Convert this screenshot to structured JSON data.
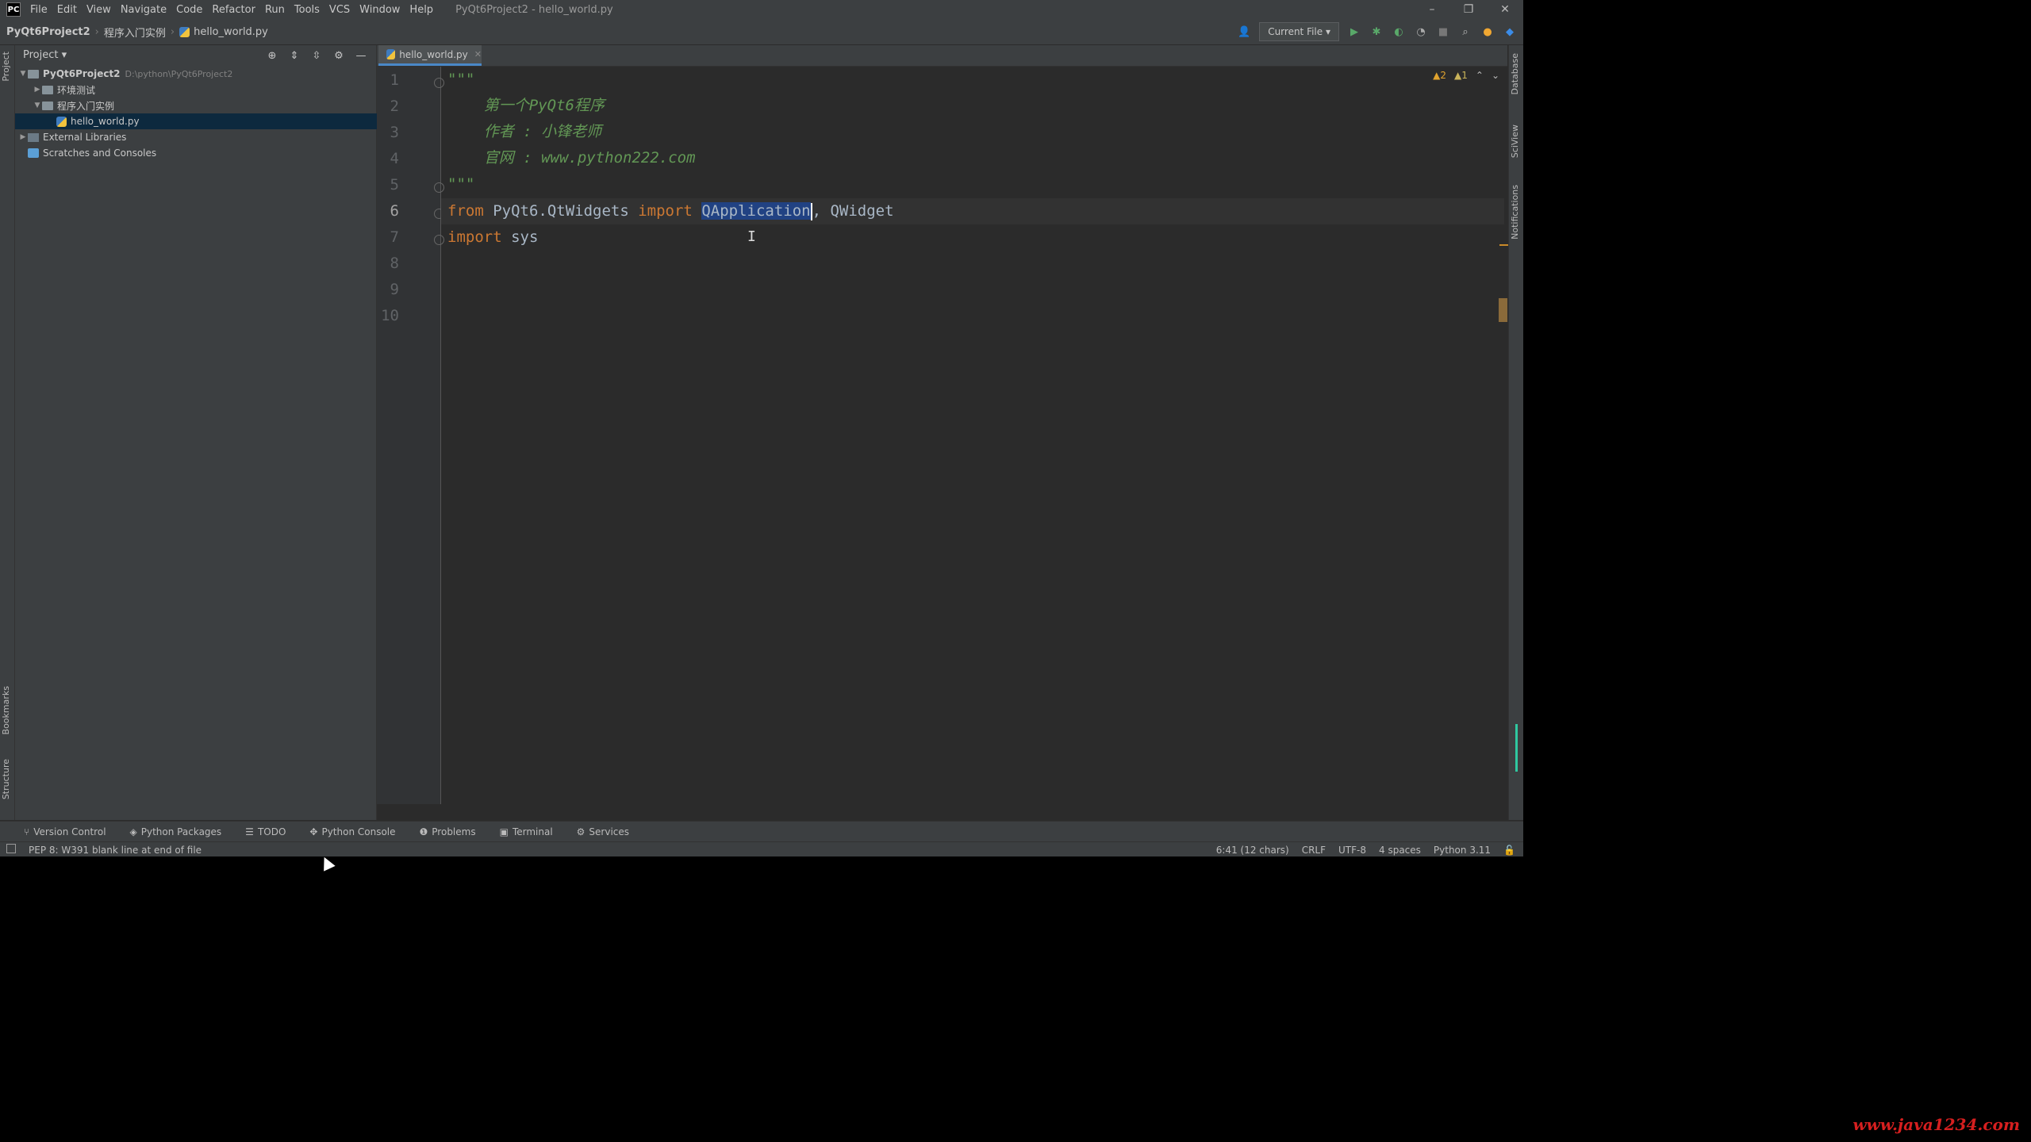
{
  "window": {
    "title": "PyQt6Project2 - hello_world.py",
    "logo": "PC",
    "controls": [
      "–",
      "❐",
      "✕"
    ]
  },
  "menu": [
    "File",
    "Edit",
    "View",
    "Navigate",
    "Code",
    "Refactor",
    "Run",
    "Tools",
    "VCS",
    "Window",
    "Help"
  ],
  "navbar": {
    "crumbs": [
      "PyQt6Project2",
      "程序入门实例",
      "hello_world.py"
    ],
    "run_config": "Current File ▾"
  },
  "left_strip": {
    "top": "Project",
    "mid": "Bookmarks",
    "bottom": "Structure"
  },
  "project_panel": {
    "title": "Project ▾",
    "tree": [
      {
        "label": "PyQt6Project2",
        "path": "D:\\python\\PyQt6Project2",
        "arrow": "▼",
        "indent": 0,
        "kind": "folder"
      },
      {
        "label": "环境测试",
        "arrow": "▶",
        "indent": 1,
        "kind": "folder"
      },
      {
        "label": "程序入门实例",
        "arrow": "▼",
        "indent": 1,
        "kind": "folder"
      },
      {
        "label": "hello_world.py",
        "arrow": "",
        "indent": 2,
        "kind": "py",
        "selected": true
      },
      {
        "label": "External Libraries",
        "arrow": "▶",
        "indent": 0,
        "kind": "lib"
      },
      {
        "label": "Scratches and Consoles",
        "arrow": "",
        "indent": 0,
        "kind": "scratch"
      }
    ]
  },
  "editor": {
    "tab": "hello_world.py",
    "inspection": {
      "warnings": "▲2",
      "weak": "▲1"
    },
    "line_numbers": [
      "1",
      "2",
      "3",
      "4",
      "5",
      "6",
      "7",
      "8",
      "9",
      "10"
    ],
    "current_line": "6",
    "lines": {
      "l1": "\"\"\"",
      "l2": "    第一个PyQt6程序",
      "l3": "    作者 : 小锋老师",
      "l4": "    官网 : www.python222.com",
      "l5": "\"\"\"",
      "l6_kw1": "from",
      "l6_mod": " PyQt6.QtWidgets ",
      "l6_kw2": "import",
      "l6_space": " ",
      "l6_sel": "QApplication",
      "l6_rest": ", QWidget",
      "l7_kw": "import",
      "l7_rest": " sys"
    }
  },
  "right_strip": {
    "a": "Database",
    "b": "SciView",
    "c": "Notifications"
  },
  "bottom_tabs": [
    "Version Control",
    "Python Packages",
    "TODO",
    "Python Console",
    "Problems",
    "Terminal",
    "Services"
  ],
  "status": {
    "message": "PEP 8: W391 blank line at end of file",
    "position": "6:41 (12 chars)",
    "line_sep": "CRLF",
    "encoding": "UTF-8",
    "indent": "4 spaces",
    "interpreter": "Python 3.11"
  },
  "watermark": "www.java1234.com",
  "colors": {
    "accent": "#4a88c7",
    "doc": "#629755",
    "keyword": "#cc7832",
    "watermark": "#d61f1f"
  }
}
